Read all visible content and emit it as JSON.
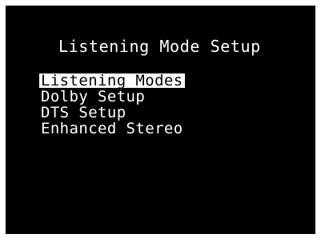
{
  "screen": {
    "title": "Listening Mode Setup",
    "menu": [
      {
        "label": "Listening Modes",
        "selected": true
      },
      {
        "label": "Dolby Setup",
        "selected": false
      },
      {
        "label": "DTS Setup",
        "selected": false
      },
      {
        "label": "Enhanced Stereo",
        "selected": false
      }
    ]
  },
  "colors": {
    "background": "#000000",
    "text": "#ffffff",
    "highlight": "#ffffff",
    "highlight_text": "#000000"
  }
}
